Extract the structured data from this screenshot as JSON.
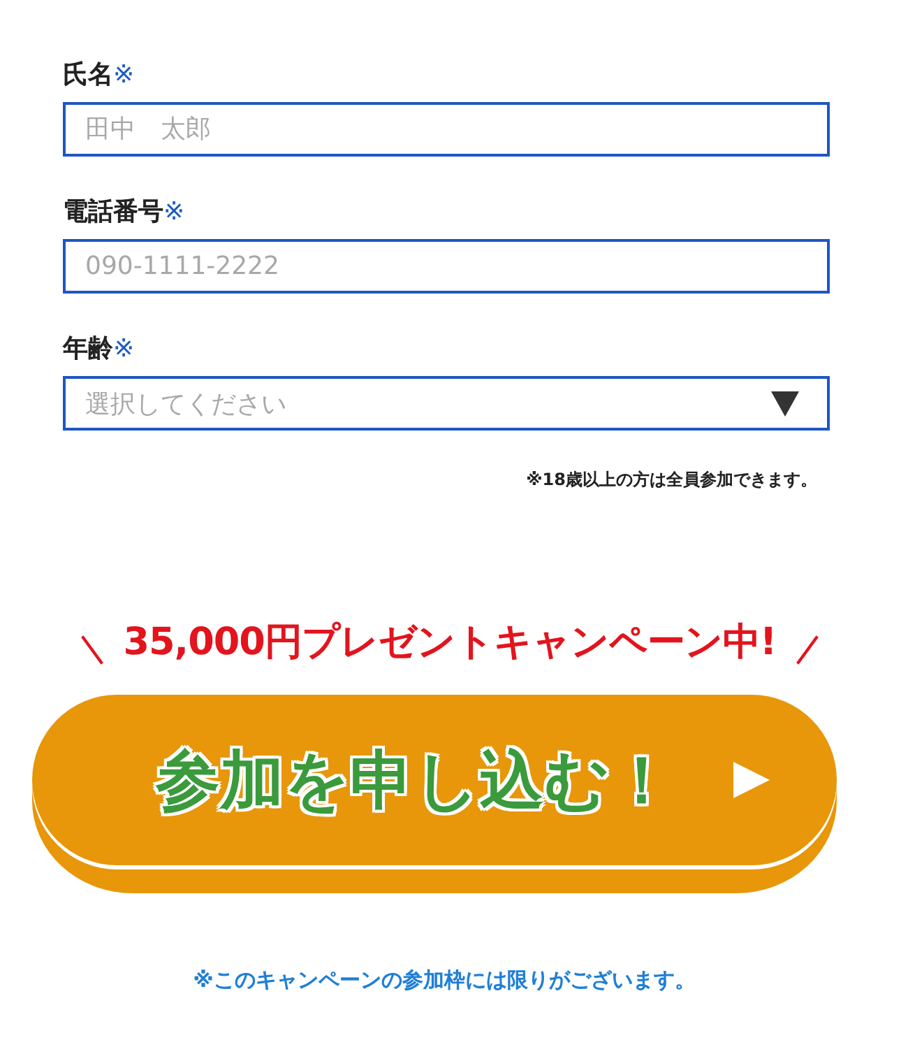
{
  "form": {
    "fields": [
      {
        "kind": "text",
        "label": "氏名",
        "required_mark": "※",
        "placeholder": "田中　太郎"
      },
      {
        "kind": "text",
        "label": "電話番号",
        "required_mark": "※",
        "placeholder": "090-1111-2222"
      },
      {
        "kind": "select",
        "label": "年齢",
        "required_mark": "※",
        "placeholder": "選択してください"
      }
    ],
    "age_note": "※18歳以上の方は全員参加できます。"
  },
  "campaign": {
    "banner": "35,000円プレゼントキャンペーン中!",
    "button": "参加を申し込む！",
    "footnote": "※このキャンペーンの参加枠には限りがございます。"
  }
}
